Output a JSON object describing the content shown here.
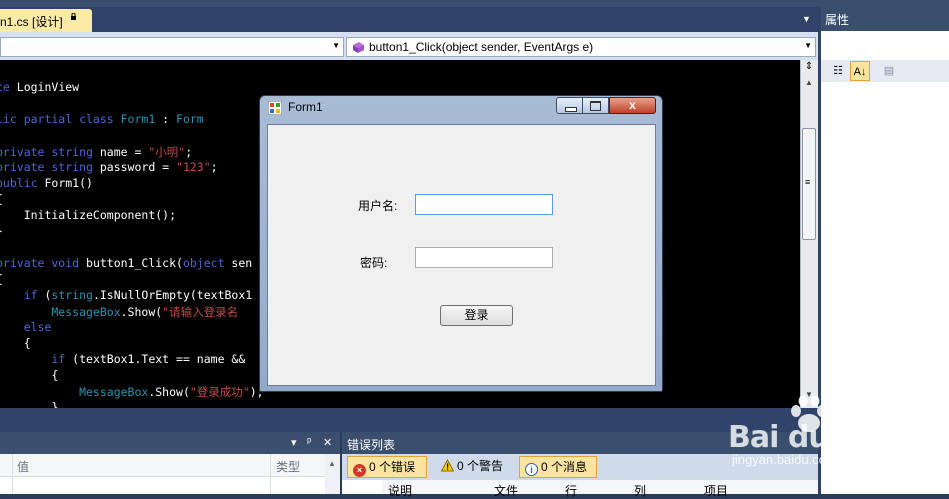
{
  "document_tab": {
    "title": "n1.cs [设计]",
    "icon": "lock-icon"
  },
  "combo": {
    "class_selector": "",
    "method_selector": "button1_Click(object sender, EventArgs e)",
    "method_icon": "method-icon"
  },
  "code_lines": [
    {
      "parts": [
        {
          "t": "ce",
          "c": "kw"
        },
        {
          "t": " LoginView",
          "c": ""
        }
      ]
    },
    {
      "parts": [
        {
          "t": "",
          "c": ""
        }
      ]
    },
    {
      "parts": [
        {
          "t": "lic partial class ",
          "c": "kw"
        },
        {
          "t": "Form1",
          "c": "ty"
        },
        {
          "t": " : ",
          "c": ""
        },
        {
          "t": "Form",
          "c": "ty"
        }
      ]
    },
    {
      "parts": [
        {
          "t": "",
          "c": ""
        }
      ]
    },
    {
      "parts": [
        {
          "t": "private string ",
          "c": "kw"
        },
        {
          "t": "name = ",
          "c": ""
        },
        {
          "t": "\"小明\"",
          "c": "st"
        },
        {
          "t": ";",
          "c": ""
        }
      ]
    },
    {
      "parts": [
        {
          "t": "private string ",
          "c": "kw"
        },
        {
          "t": "password = ",
          "c": ""
        },
        {
          "t": "\"123\"",
          "c": "st"
        },
        {
          "t": ";",
          "c": ""
        }
      ]
    },
    {
      "parts": [
        {
          "t": "public ",
          "c": "kw"
        },
        {
          "t": "Form1()",
          "c": ""
        }
      ]
    },
    {
      "parts": [
        {
          "t": "{",
          "c": ""
        }
      ]
    },
    {
      "parts": [
        {
          "t": "    InitializeComponent();",
          "c": ""
        }
      ]
    },
    {
      "parts": [
        {
          "t": "}",
          "c": ""
        }
      ]
    },
    {
      "parts": [
        {
          "t": "",
          "c": ""
        }
      ]
    },
    {
      "parts": [
        {
          "t": "private void ",
          "c": "kw"
        },
        {
          "t": "button1_Click(",
          "c": ""
        },
        {
          "t": "object ",
          "c": "kw"
        },
        {
          "t": "sen",
          "c": ""
        }
      ]
    },
    {
      "parts": [
        {
          "t": "{",
          "c": ""
        }
      ]
    },
    {
      "parts": [
        {
          "t": "    if ",
          "c": "kw"
        },
        {
          "t": "(",
          "c": ""
        },
        {
          "t": "string",
          "c": "ty"
        },
        {
          "t": ".IsNullOrEmpty(textBox1",
          "c": ""
        }
      ]
    },
    {
      "parts": [
        {
          "t": "        MessageBox",
          "c": "ty"
        },
        {
          "t": ".Show(",
          "c": ""
        },
        {
          "t": "\"请输入登录名",
          "c": "st"
        }
      ]
    },
    {
      "parts": [
        {
          "t": "    else",
          "c": "kw"
        }
      ]
    },
    {
      "parts": [
        {
          "t": "    {",
          "c": ""
        }
      ]
    },
    {
      "parts": [
        {
          "t": "        if ",
          "c": "kw"
        },
        {
          "t": "(textBox1.Text == name && ",
          "c": ""
        }
      ]
    },
    {
      "parts": [
        {
          "t": "        {",
          "c": ""
        }
      ]
    },
    {
      "parts": [
        {
          "t": "            MessageBox",
          "c": "ty"
        },
        {
          "t": ".Show(",
          "c": ""
        },
        {
          "t": "\"登录成功\"",
          "c": "st"
        },
        {
          "t": ");",
          "c": ""
        }
      ]
    },
    {
      "parts": [
        {
          "t": "        }",
          "c": ""
        }
      ]
    }
  ],
  "properties": {
    "title": "属性"
  },
  "form1": {
    "title": "Form1",
    "close_glyph": "x",
    "username_label": "用户名:",
    "username_value": "",
    "password_label": "密码:",
    "password_value": "",
    "login_button": "登录"
  },
  "locals_panel": {
    "col_value": "值",
    "col_type": "类型",
    "pin": "ᵖ",
    "dropdown": "▾",
    "close": "✕"
  },
  "error_list": {
    "title": "错误列表",
    "errors": "0 个错误",
    "warnings": "0 个警告",
    "messages": "0 个消息",
    "columns": [
      "说明",
      "文件",
      "行",
      "列",
      "项目"
    ]
  },
  "watermark": {
    "logo": "Bai du 经验",
    "url": "jingyan.baidu.com"
  },
  "colors": {
    "ide_chrome": "#2f4468",
    "highlight": "#fbe9a6",
    "keyword": "#4a68d6",
    "type": "#2b91af",
    "string": "#c14a4a"
  }
}
